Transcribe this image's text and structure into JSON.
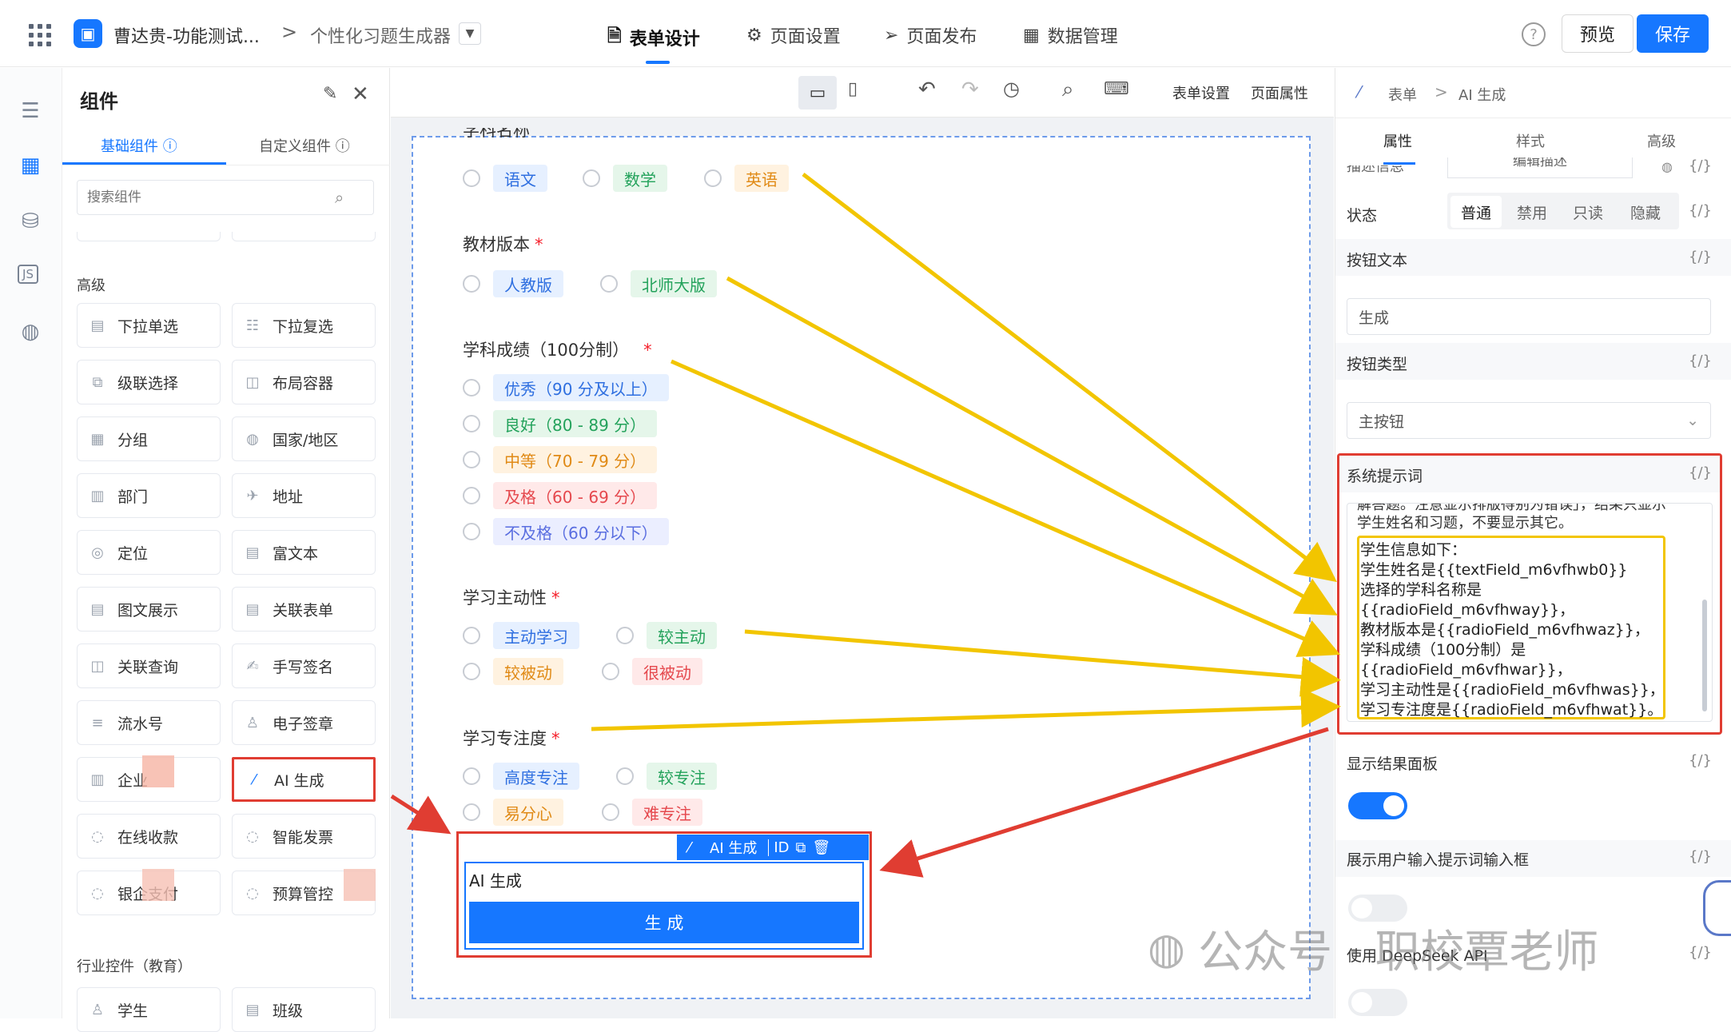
{
  "topbar": {
    "app_name": "曹达贵-功能测试...",
    "page_name": "个性化习题生成器",
    "tabs": [
      {
        "label": "表单设计"
      },
      {
        "label": "页面设置"
      },
      {
        "label": "页面发布"
      },
      {
        "label": "数据管理"
      }
    ],
    "preview_label": "预览",
    "save_label": "保存",
    "help_icon": "?"
  },
  "panel": {
    "title": "组件",
    "tabs": [
      {
        "label": "基础组件"
      },
      {
        "label": "自定义组件"
      }
    ],
    "search_placeholder": "搜索组件",
    "section_advanced": "高级",
    "section_industry": "行业控件（教育）",
    "components": [
      {
        "label": "下拉单选"
      },
      {
        "label": "下拉复选"
      },
      {
        "label": "级联选择"
      },
      {
        "label": "布局容器"
      },
      {
        "label": "分组"
      },
      {
        "label": "国家/地区"
      },
      {
        "label": "部门"
      },
      {
        "label": "地址"
      },
      {
        "label": "定位"
      },
      {
        "label": "富文本"
      },
      {
        "label": "图文展示"
      },
      {
        "label": "关联表单"
      },
      {
        "label": "关联查询"
      },
      {
        "label": "手写签名"
      },
      {
        "label": "流水号"
      },
      {
        "label": "电子签章"
      },
      {
        "label": "企业"
      },
      {
        "label": "AI 生成"
      },
      {
        "label": "在线收款"
      },
      {
        "label": "智能发票"
      },
      {
        "label": "银企支付"
      },
      {
        "label": "预算管控"
      }
    ],
    "industry": [
      {
        "label": "学生"
      },
      {
        "label": "班级"
      }
    ]
  },
  "toolbar": {
    "form_settings": "表单设置",
    "page_props": "页面属性"
  },
  "form": {
    "subject": {
      "label": "学科名称",
      "options": [
        "语文",
        "数学",
        "英语"
      ]
    },
    "edition": {
      "label": "教材版本",
      "options": [
        "人教版",
        "北师大版"
      ]
    },
    "score": {
      "label": "学科成绩（100分制）",
      "options": [
        "优秀（90 分及以上）",
        "良好（80 - 89 分）",
        "中等（70 - 79 分）",
        "及格（60 - 69 分）",
        "不及格（60 分以下）"
      ]
    },
    "initiative": {
      "label": "学习主动性",
      "options": [
        "主动学习",
        "较主动",
        "较被动",
        "很被动"
      ]
    },
    "focus": {
      "label": "学习专注度",
      "options": [
        "高度专注",
        "较专注",
        "易分心",
        "难专注"
      ]
    },
    "ai": {
      "toolbar_label": "AI 生成",
      "id_label": "ID",
      "input_value": "AI 生成",
      "button_label": "生 成"
    }
  },
  "right": {
    "breadcrumb": {
      "root": "表单",
      "current": "AI 生成"
    },
    "tabs": [
      {
        "label": "属性"
      },
      {
        "label": "样式"
      },
      {
        "label": "高级"
      }
    ],
    "cut_label": "描述信息",
    "cut_input": "编辑描述",
    "status_label": "状态",
    "status_options": [
      "普通",
      "禁用",
      "只读",
      "隐藏"
    ],
    "btn_text_label": "按钮文本",
    "btn_text_value": "生成",
    "btn_type_label": "按钮类型",
    "btn_type_value": "主按钮",
    "prompt_label": "系统提示词",
    "prompt_cut": "解答题。注意显示排版得别为错误」，结果只显示学生姓名和习题，不要显示其它。",
    "prompt_lines": [
      "学生信息如下：",
      "学生姓名是{{textField_m6vfhwb0}}",
      "选择的学科名称是",
      "{{radioField_m6vfhway}}，",
      "教材版本是{{radioField_m6vfhwaz}}，",
      "学科成绩（100分制）是",
      "{{radioField_m6vfhwar}}，",
      "学习主动性是{{radioField_m6vfhwas}}，",
      "学习专注度是{{radioField_m6vfhwat}}。"
    ],
    "result_panel_label": "显示结果面板",
    "show_input_label": "展示用户输入提示词输入框",
    "deepseek_label": "使用 DeepSeek API",
    "fx": "{/}"
  },
  "watermark": "公众号 · 职校覃老师"
}
